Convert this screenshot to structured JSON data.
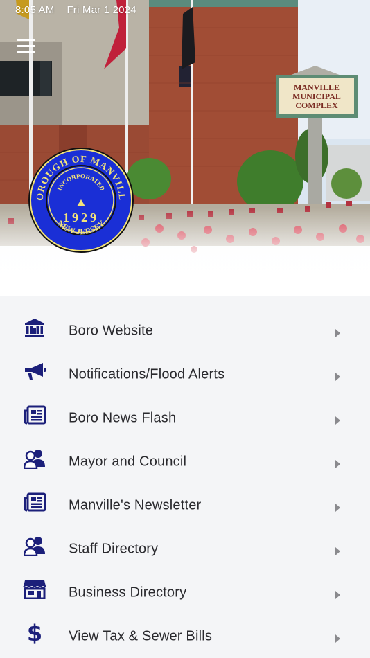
{
  "status_bar": {
    "time": "8:05 AM",
    "date": "Fri Mar 1 2024"
  },
  "header": {
    "building_sign": [
      "MANVILLE",
      "MUNICIPAL",
      "COMPLEX"
    ],
    "seal": {
      "top_text": "BOROUGH OF MANVILLE",
      "middle_text": "INCORPORATED",
      "year": "1929",
      "bottom_text": "NEW JERSEY"
    }
  },
  "colors": {
    "icon": "#1b1f7a",
    "seal_blue": "#1a2fd6",
    "seal_gold": "#f3e37a",
    "list_bg": "#f4f5f7"
  },
  "menu": [
    {
      "label": "Boro Website",
      "icon": "government-building-icon"
    },
    {
      "label": "Notifications/Flood Alerts",
      "icon": "megaphone-icon"
    },
    {
      "label": "Boro News Flash",
      "icon": "newspaper-icon"
    },
    {
      "label": "Mayor and Council",
      "icon": "people-group-icon"
    },
    {
      "label": "Manville's Newsletter",
      "icon": "newspaper-icon"
    },
    {
      "label": "Staff Directory",
      "icon": "people-group-icon"
    },
    {
      "label": "Business Directory",
      "icon": "storefront-icon"
    },
    {
      "label": "View Tax & Sewer Bills",
      "icon": "dollar-sign-icon"
    }
  ]
}
